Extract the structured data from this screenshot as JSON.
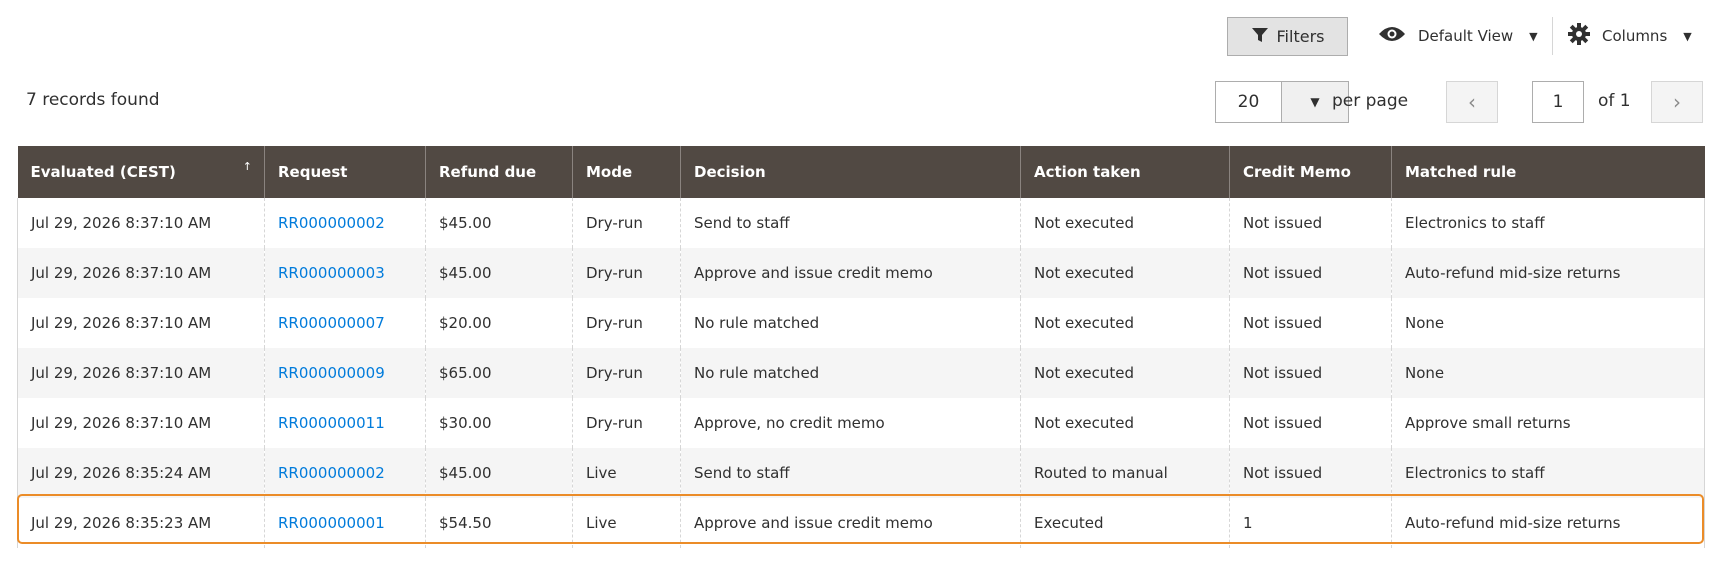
{
  "toolbar": {
    "filters_label": "Filters",
    "view_label": "Default View",
    "columns_label": "Columns"
  },
  "records_text": "7 records found",
  "pager": {
    "per_page_value": "20",
    "per_page_label": "per page",
    "current_page": "1",
    "of_label": "of 1"
  },
  "grid": {
    "columns": [
      "Evaluated (CEST)",
      "Request",
      "Refund due",
      "Mode",
      "Decision",
      "Action taken",
      "Credit Memo",
      "Matched rule"
    ],
    "sort_indicator": "↑",
    "rows": [
      {
        "evaluated": "Jul 29, 2026 8:37:10 AM",
        "request": "RR000000002",
        "refund": "$45.00",
        "mode": "Dry-run",
        "decision": "Send to staff",
        "action": "Not executed",
        "memo": "Not issued",
        "rule": "Electronics to staff"
      },
      {
        "evaluated": "Jul 29, 2026 8:37:10 AM",
        "request": "RR000000003",
        "refund": "$45.00",
        "mode": "Dry-run",
        "decision": "Approve and issue credit memo",
        "action": "Not executed",
        "memo": "Not issued",
        "rule": "Auto-refund mid-size returns"
      },
      {
        "evaluated": "Jul 29, 2026 8:37:10 AM",
        "request": "RR000000007",
        "refund": "$20.00",
        "mode": "Dry-run",
        "decision": "No rule matched",
        "action": "Not executed",
        "memo": "Not issued",
        "rule": "None"
      },
      {
        "evaluated": "Jul 29, 2026 8:37:10 AM",
        "request": "RR000000009",
        "refund": "$65.00",
        "mode": "Dry-run",
        "decision": "No rule matched",
        "action": "Not executed",
        "memo": "Not issued",
        "rule": "None"
      },
      {
        "evaluated": "Jul 29, 2026 8:37:10 AM",
        "request": "RR000000011",
        "refund": "$30.00",
        "mode": "Dry-run",
        "decision": "Approve, no credit memo",
        "action": "Not executed",
        "memo": "Not issued",
        "rule": "Approve small returns"
      },
      {
        "evaluated": "Jul 29, 2026 8:35:24 AM",
        "request": "RR000000002",
        "refund": "$45.00",
        "mode": "Live",
        "decision": "Send to staff",
        "action": "Routed to manual",
        "memo": "Not issued",
        "rule": "Electronics to staff"
      },
      {
        "evaluated": "Jul 29, 2026 8:35:23 AM",
        "request": "RR000000001",
        "refund": "$54.50",
        "mode": "Live",
        "decision": "Approve and issue credit memo",
        "action": "Executed",
        "memo": "1",
        "rule": "Auto-refund mid-size returns"
      }
    ]
  },
  "colors": {
    "header_bg": "#514943",
    "link": "#007bdb",
    "highlight": "#eb8c28"
  },
  "icons": {
    "filters": "funnel-icon",
    "view": "eye-icon",
    "columns": "gear-icon"
  }
}
